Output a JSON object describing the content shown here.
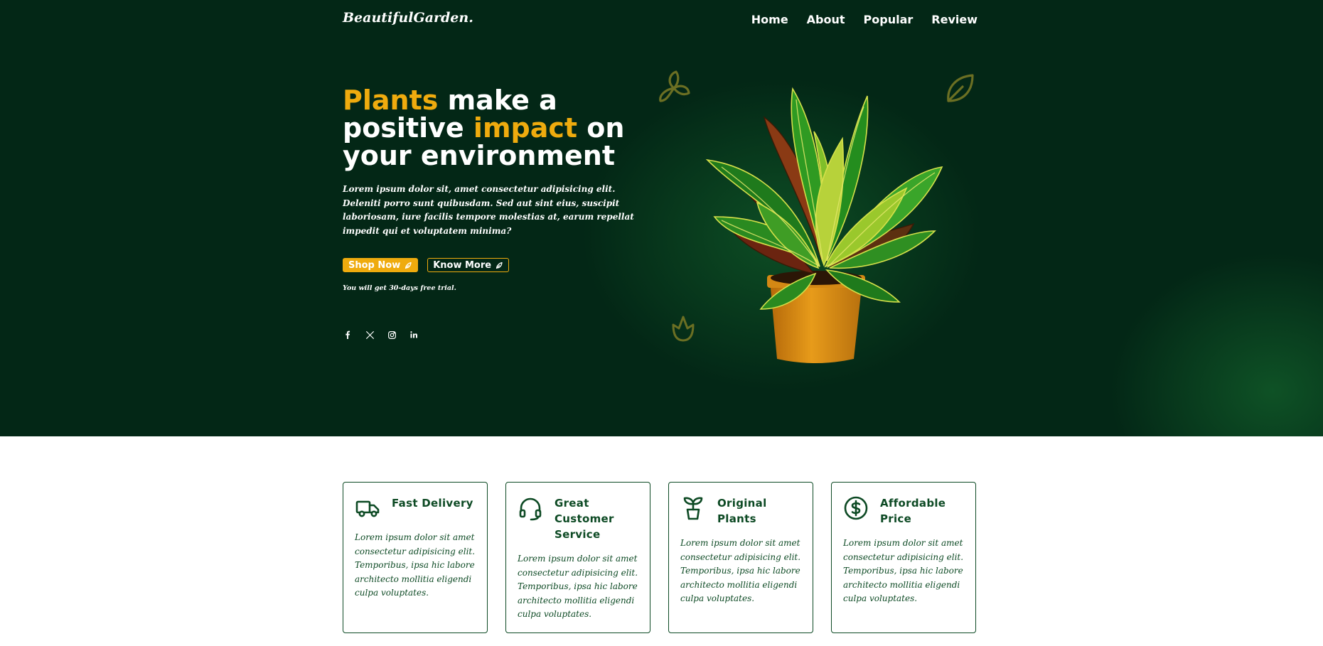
{
  "brand": {
    "logo": "BeautifulGarden."
  },
  "nav": [
    {
      "label": "Home"
    },
    {
      "label": "About"
    },
    {
      "label": "Popular"
    },
    {
      "label": "Review"
    }
  ],
  "hero": {
    "headline": {
      "part1": "Plants",
      "part2": " make a ",
      "part3": "positive ",
      "part4": "impact",
      "part5": " on ",
      "part6": "your environment"
    },
    "description": "Lorem ipsum dolor sit, amet consectetur adipisicing elit. Deleniti porro sunt quibusdam. Sed aut sint eius, suscipit laboriosam, iure facilis tempore molestias at, earum repellat impedit qui et voluptatem minima?",
    "buttons": {
      "shop": "Shop Now",
      "more": "Know More"
    },
    "trial": "You will get 30-days free trial.",
    "socials": [
      "facebook-icon",
      "x-icon",
      "instagram-icon",
      "linkedin-icon"
    ]
  },
  "colors": {
    "hero_bg": "#032716",
    "accent": "#efab0e",
    "green": "#0d4a24"
  },
  "features": [
    {
      "title": "Fast Delivery",
      "icon": "truck-icon",
      "text": "Lorem ipsum dolor sit amet consectetur adipisicing elit. Temporibus, ipsa hic labore architecto mollitia eligendi culpa voluptates."
    },
    {
      "title": "Great Customer Service",
      "icon": "headset-icon",
      "text": "Lorem ipsum dolor sit amet consectetur adipisicing elit. Temporibus, ipsa hic labore architecto mollitia eligendi culpa voluptates."
    },
    {
      "title": "Original Plants",
      "icon": "sprout-pot-icon",
      "text": "Lorem ipsum dolor sit amet consectetur adipisicing elit. Temporibus, ipsa hic labore architecto mollitia eligendi culpa voluptates."
    },
    {
      "title": "Affordable Price",
      "icon": "dollar-coin-icon",
      "text": "Lorem ipsum dolor sit amet consectetur adipisicing elit. Temporibus, ipsa hic labore architecto mollitia eligendi culpa voluptates."
    }
  ]
}
